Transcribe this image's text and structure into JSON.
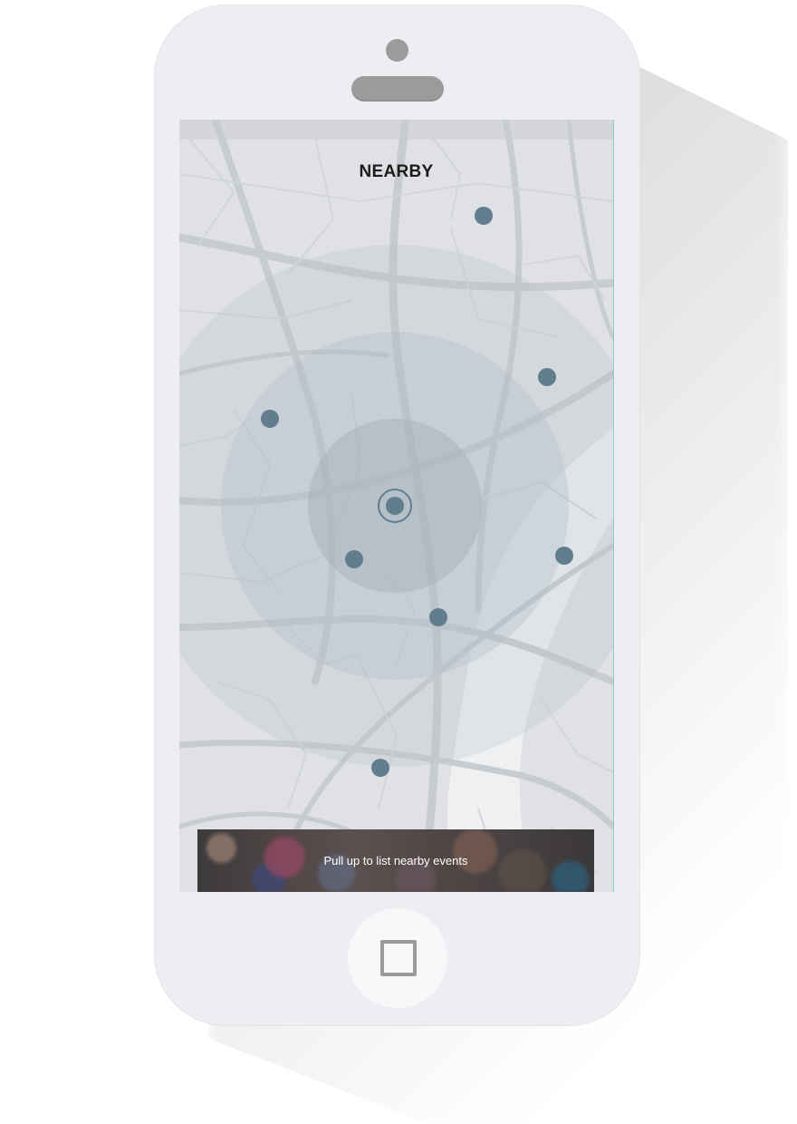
{
  "header": {
    "title": "NEARBY"
  },
  "panel": {
    "label": "Pull up to list nearby events"
  },
  "icons": {
    "camera": "front-camera-icon",
    "speaker": "earpiece-speaker-icon",
    "home": "home-square-icon",
    "location": "current-location-icon",
    "marker": "event-marker-icon"
  },
  "colors": {
    "marker": "#617d8e",
    "radar_ring": "#aebcc6",
    "map_background": "#dfe1e4",
    "map_roads": "#c9cccf",
    "phone_body": "#eceef1"
  },
  "markers": [
    {
      "id": "event-1"
    },
    {
      "id": "event-2"
    },
    {
      "id": "event-3"
    },
    {
      "id": "event-4"
    },
    {
      "id": "event-5"
    },
    {
      "id": "event-6"
    },
    {
      "id": "event-7"
    }
  ]
}
